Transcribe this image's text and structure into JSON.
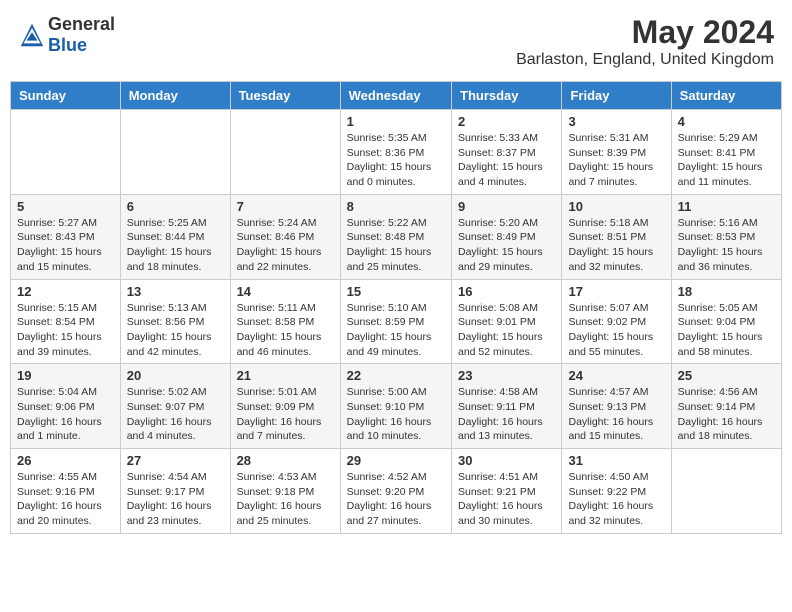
{
  "header": {
    "logo_general": "General",
    "logo_blue": "Blue",
    "month_year": "May 2024",
    "location": "Barlaston, England, United Kingdom"
  },
  "days_of_week": [
    "Sunday",
    "Monday",
    "Tuesday",
    "Wednesday",
    "Thursday",
    "Friday",
    "Saturday"
  ],
  "weeks": [
    [
      {
        "day": "",
        "details": ""
      },
      {
        "day": "",
        "details": ""
      },
      {
        "day": "",
        "details": ""
      },
      {
        "day": "1",
        "details": "Sunrise: 5:35 AM\nSunset: 8:36 PM\nDaylight: 15 hours\nand 0 minutes."
      },
      {
        "day": "2",
        "details": "Sunrise: 5:33 AM\nSunset: 8:37 PM\nDaylight: 15 hours\nand 4 minutes."
      },
      {
        "day": "3",
        "details": "Sunrise: 5:31 AM\nSunset: 8:39 PM\nDaylight: 15 hours\nand 7 minutes."
      },
      {
        "day": "4",
        "details": "Sunrise: 5:29 AM\nSunset: 8:41 PM\nDaylight: 15 hours\nand 11 minutes."
      }
    ],
    [
      {
        "day": "5",
        "details": "Sunrise: 5:27 AM\nSunset: 8:43 PM\nDaylight: 15 hours\nand 15 minutes."
      },
      {
        "day": "6",
        "details": "Sunrise: 5:25 AM\nSunset: 8:44 PM\nDaylight: 15 hours\nand 18 minutes."
      },
      {
        "day": "7",
        "details": "Sunrise: 5:24 AM\nSunset: 8:46 PM\nDaylight: 15 hours\nand 22 minutes."
      },
      {
        "day": "8",
        "details": "Sunrise: 5:22 AM\nSunset: 8:48 PM\nDaylight: 15 hours\nand 25 minutes."
      },
      {
        "day": "9",
        "details": "Sunrise: 5:20 AM\nSunset: 8:49 PM\nDaylight: 15 hours\nand 29 minutes."
      },
      {
        "day": "10",
        "details": "Sunrise: 5:18 AM\nSunset: 8:51 PM\nDaylight: 15 hours\nand 32 minutes."
      },
      {
        "day": "11",
        "details": "Sunrise: 5:16 AM\nSunset: 8:53 PM\nDaylight: 15 hours\nand 36 minutes."
      }
    ],
    [
      {
        "day": "12",
        "details": "Sunrise: 5:15 AM\nSunset: 8:54 PM\nDaylight: 15 hours\nand 39 minutes."
      },
      {
        "day": "13",
        "details": "Sunrise: 5:13 AM\nSunset: 8:56 PM\nDaylight: 15 hours\nand 42 minutes."
      },
      {
        "day": "14",
        "details": "Sunrise: 5:11 AM\nSunset: 8:58 PM\nDaylight: 15 hours\nand 46 minutes."
      },
      {
        "day": "15",
        "details": "Sunrise: 5:10 AM\nSunset: 8:59 PM\nDaylight: 15 hours\nand 49 minutes."
      },
      {
        "day": "16",
        "details": "Sunrise: 5:08 AM\nSunset: 9:01 PM\nDaylight: 15 hours\nand 52 minutes."
      },
      {
        "day": "17",
        "details": "Sunrise: 5:07 AM\nSunset: 9:02 PM\nDaylight: 15 hours\nand 55 minutes."
      },
      {
        "day": "18",
        "details": "Sunrise: 5:05 AM\nSunset: 9:04 PM\nDaylight: 15 hours\nand 58 minutes."
      }
    ],
    [
      {
        "day": "19",
        "details": "Sunrise: 5:04 AM\nSunset: 9:06 PM\nDaylight: 16 hours\nand 1 minute."
      },
      {
        "day": "20",
        "details": "Sunrise: 5:02 AM\nSunset: 9:07 PM\nDaylight: 16 hours\nand 4 minutes."
      },
      {
        "day": "21",
        "details": "Sunrise: 5:01 AM\nSunset: 9:09 PM\nDaylight: 16 hours\nand 7 minutes."
      },
      {
        "day": "22",
        "details": "Sunrise: 5:00 AM\nSunset: 9:10 PM\nDaylight: 16 hours\nand 10 minutes."
      },
      {
        "day": "23",
        "details": "Sunrise: 4:58 AM\nSunset: 9:11 PM\nDaylight: 16 hours\nand 13 minutes."
      },
      {
        "day": "24",
        "details": "Sunrise: 4:57 AM\nSunset: 9:13 PM\nDaylight: 16 hours\nand 15 minutes."
      },
      {
        "day": "25",
        "details": "Sunrise: 4:56 AM\nSunset: 9:14 PM\nDaylight: 16 hours\nand 18 minutes."
      }
    ],
    [
      {
        "day": "26",
        "details": "Sunrise: 4:55 AM\nSunset: 9:16 PM\nDaylight: 16 hours\nand 20 minutes."
      },
      {
        "day": "27",
        "details": "Sunrise: 4:54 AM\nSunset: 9:17 PM\nDaylight: 16 hours\nand 23 minutes."
      },
      {
        "day": "28",
        "details": "Sunrise: 4:53 AM\nSunset: 9:18 PM\nDaylight: 16 hours\nand 25 minutes."
      },
      {
        "day": "29",
        "details": "Sunrise: 4:52 AM\nSunset: 9:20 PM\nDaylight: 16 hours\nand 27 minutes."
      },
      {
        "day": "30",
        "details": "Sunrise: 4:51 AM\nSunset: 9:21 PM\nDaylight: 16 hours\nand 30 minutes."
      },
      {
        "day": "31",
        "details": "Sunrise: 4:50 AM\nSunset: 9:22 PM\nDaylight: 16 hours\nand 32 minutes."
      },
      {
        "day": "",
        "details": ""
      }
    ]
  ]
}
